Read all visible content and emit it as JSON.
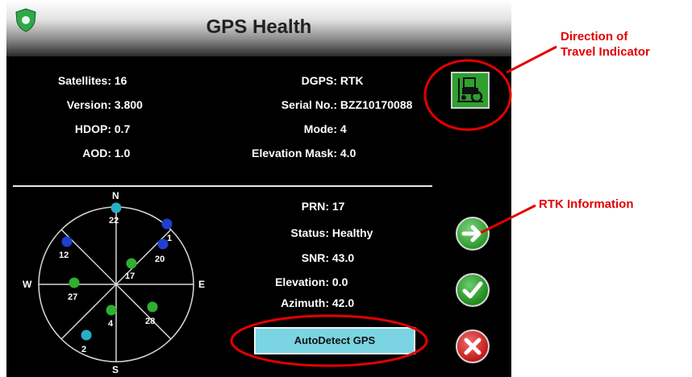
{
  "header": {
    "title": "GPS Health"
  },
  "left_info": [
    {
      "label": "Satellites:",
      "value": "16"
    },
    {
      "label": "Version:",
      "value": "3.800"
    },
    {
      "label": "HDOP:",
      "value": "0.7"
    },
    {
      "label": "AOD:",
      "value": "1.0"
    }
  ],
  "right_info": [
    {
      "label": "DGPS:",
      "value": "RTK"
    },
    {
      "label": "Serial No.:",
      "value": "BZZ10170088"
    },
    {
      "label": "Mode:",
      "value": "4"
    },
    {
      "label": "Elevation Mask:",
      "value": "4.0"
    }
  ],
  "satellite_info": [
    {
      "label": "PRN:",
      "value": "17"
    },
    {
      "label": "Status:",
      "value": "Healthy"
    },
    {
      "label": "SNR:",
      "value": "43.0"
    },
    {
      "label": "Elevation:",
      "value": "0.0"
    },
    {
      "label": "Azimuth:",
      "value": "42.0"
    }
  ],
  "compass": {
    "n": "N",
    "s": "S",
    "e": "E",
    "w": "W"
  },
  "satellites": [
    {
      "prn": "22",
      "color": "#29aec3"
    },
    {
      "prn": "1",
      "color": "#1f3fd0"
    },
    {
      "prn": "20",
      "color": "#1f3fd0"
    },
    {
      "prn": "12",
      "color": "#1f3fd0"
    },
    {
      "prn": "17",
      "color": "#2fb02f"
    },
    {
      "prn": "27",
      "color": "#2fb02f"
    },
    {
      "prn": "4",
      "color": "#2fb02f"
    },
    {
      "prn": "28",
      "color": "#2fb02f"
    },
    {
      "prn": "2",
      "color": "#29aec3"
    }
  ],
  "buttons": {
    "autodetect": "AutoDetect GPS"
  },
  "annotations": {
    "direction_line1": "Direction of",
    "direction_line2": "Travel Indicator",
    "rtk": "RTK Information"
  },
  "colors": {
    "annotation_red": "#e30000",
    "button_green": "#2fa02f",
    "cancel_red": "#c21818"
  }
}
